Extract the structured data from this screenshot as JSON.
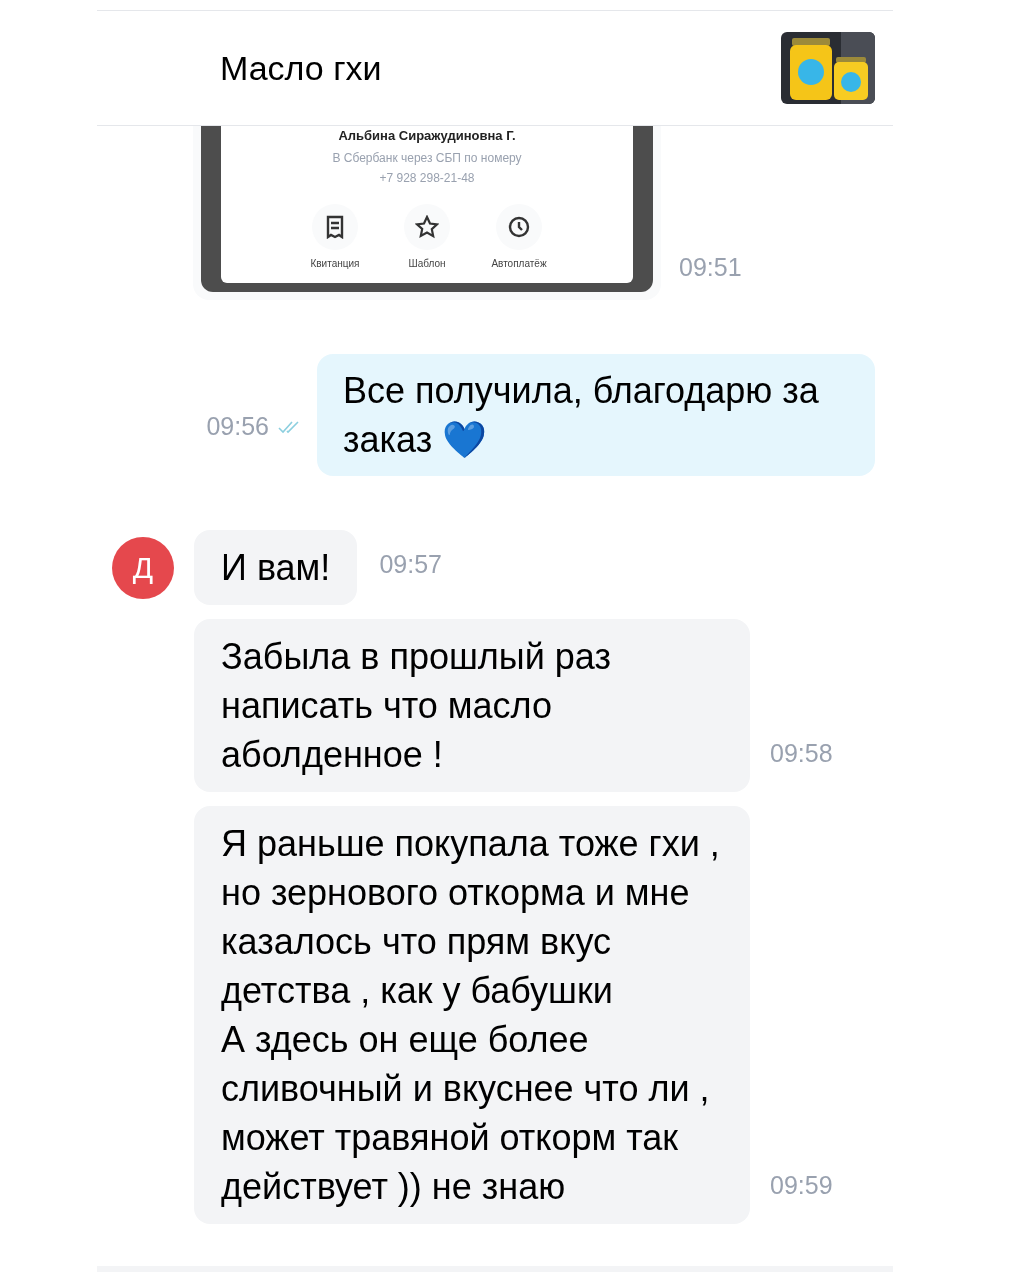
{
  "header": {
    "title": "Масло гхи"
  },
  "messages": [
    {
      "kind": "screenshot",
      "outgoing": false,
      "time": "09:51",
      "payee": "Альбина Сиражудиновна Г.",
      "bank_line": "В Сбербанк через СБП по номеру",
      "phone": "+7 928 298-21-48",
      "actions": [
        {
          "label": "Квитанция"
        },
        {
          "label": "Шаблон"
        },
        {
          "label": "Автоплатёж"
        }
      ]
    },
    {
      "kind": "text",
      "outgoing": true,
      "text": "Все получила, благодарю за заказ 💙",
      "time": "09:56",
      "read": true
    },
    {
      "kind": "text",
      "outgoing": false,
      "avatar": "Д",
      "text": "И вам!",
      "time": "09:57"
    },
    {
      "kind": "text",
      "outgoing": false,
      "text": "Забыла в прошлый раз написать что масло аболденное !",
      "time": "09:58"
    },
    {
      "kind": "text",
      "outgoing": false,
      "text": "Я раньше покупала тоже гхи , но зернового откорма и мне казалось что прям вкус детства , как у бабушки\nА здесь он еще более сливочный и вкуснее что ли , может травяной откорм так действует )) не знаю",
      "time": "09:59"
    }
  ]
}
